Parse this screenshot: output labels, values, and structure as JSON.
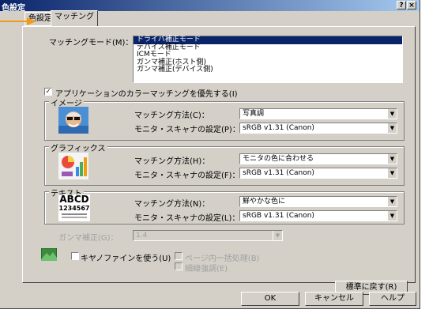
{
  "window": {
    "title": "色設定",
    "help_glyph": "?",
    "close_glyph": "×"
  },
  "tabs": [
    {
      "label": "色設定"
    },
    {
      "label": "マッチング"
    }
  ],
  "matching_mode": {
    "label": "マッチングモード(M)：",
    "options": [
      {
        "label": "ドライバ補正モード",
        "selected": true
      },
      {
        "label": "デバイス補正モード",
        "selected": false
      },
      {
        "label": "ICMモード",
        "selected": false
      },
      {
        "label": "ガンマ補正(ホスト側)",
        "selected": false
      },
      {
        "label": "ガンマ補正(デバイス側)",
        "selected": false
      }
    ]
  },
  "app_priority": {
    "label": "アプリケーションのカラーマッチングを優先する(I)",
    "checked": true
  },
  "image_group": {
    "title": "イメージ",
    "method_label": "マッチング方法(C)：",
    "method_value": "写真調",
    "monitor_label": "モニタ・スキャナの設定(P)：",
    "monitor_value": "sRGB v1.31 (Canon)"
  },
  "graphics_group": {
    "title": "グラフィックス",
    "method_label": "マッチング方法(H)：",
    "method_value": "モニタの色に合わせる",
    "monitor_label": "モニタ・スキャナの設定(F)：",
    "monitor_value": "sRGB v1.31 (Canon)"
  },
  "text_group": {
    "title": "テキスト",
    "sample_big": "ABCD",
    "sample_small": "1234567",
    "method_label": "マッチング方法(N)：",
    "method_value": "鮮やかな色に",
    "monitor_label": "モニタ・スキャナの設定(L)：",
    "monitor_value": "sRGB v1.31 (Canon)"
  },
  "gamma": {
    "label": "ガンマ補正(G)：",
    "value": "1.4"
  },
  "canon_fine": {
    "label": "キヤノファインを使う(U)",
    "checked": false
  },
  "page_batch": {
    "label": "ページ内一括処理(B)",
    "checked": false
  },
  "fine_line": {
    "label": "細線強調(E)",
    "checked": false
  },
  "buttons": {
    "restore": "標準に戻す(R)",
    "ok": "OK",
    "cancel": "キャンセル",
    "help": "ヘルプ"
  },
  "colors": {
    "title_start": "#0a246a",
    "title_end": "#a6caf0",
    "pointer_arrow": "#f29a18",
    "dialog_bg": "#d4d0c8"
  }
}
